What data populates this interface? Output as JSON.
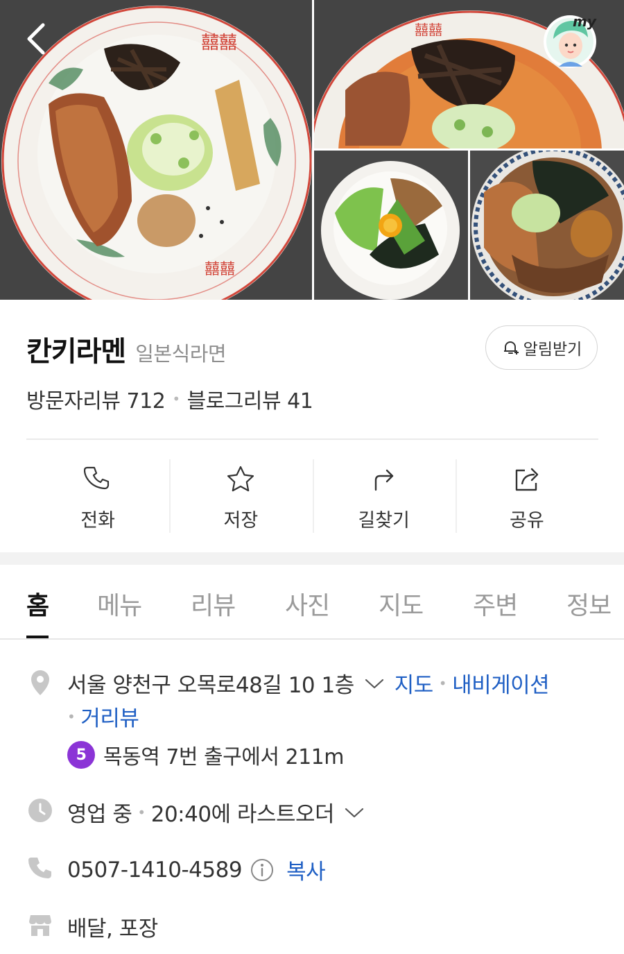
{
  "gallery": {
    "photos": [
      "ramen-photo-main",
      "ramen-photo-spicy",
      "mazesoba-photo",
      "donburi-photo"
    ]
  },
  "place": {
    "name": "칸키라멘",
    "category": "일본식라면",
    "alarm_label": "알림받기",
    "visitor_review_label": "방문자리뷰",
    "visitor_review_count": "712",
    "blog_review_label": "블로그리뷰",
    "blog_review_count": "41"
  },
  "actions": [
    {
      "label": "전화",
      "icon": "phone-icon"
    },
    {
      "label": "저장",
      "icon": "star-icon"
    },
    {
      "label": "길찾기",
      "icon": "directions-icon"
    },
    {
      "label": "공유",
      "icon": "share-icon"
    }
  ],
  "tabs": [
    "홈",
    "메뉴",
    "리뷰",
    "사진",
    "지도",
    "주변",
    "정보"
  ],
  "active_tab": "홈",
  "info": {
    "address": "서울 양천구 오목로48길 10 1층",
    "map_link": "지도",
    "navigation_link": "내비게이션",
    "street_view_link": "거리뷰",
    "subway_line": "5",
    "subway_line_color": "#8b34d6",
    "subway_text": "목동역 7번 출구에서 211m",
    "status": "영업 중",
    "last_order": "20:40에 라스트오더",
    "phone": "0507-1410-4589",
    "copy_label": "복사",
    "services": "배달, 포장"
  },
  "colors": {
    "link": "#1f5fc4",
    "divider": "#eaeaea",
    "band": "#f2f2f2"
  }
}
